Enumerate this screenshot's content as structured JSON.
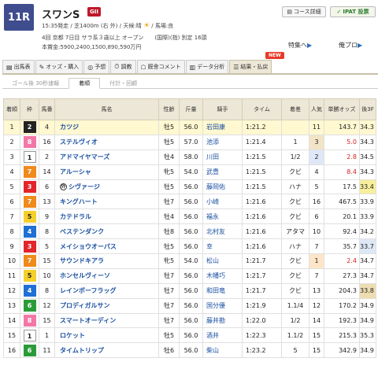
{
  "race": {
    "number": "11R",
    "name": "スワンS",
    "grade": "GII",
    "info1": "15:35発走 / 芝1400m (右 外) / 天候:晴",
    "weather_icon": "sun-icon",
    "info1_tail": "/ 馬場:良",
    "info2": "4回 京都 7日目 サラ系３歳以上 オープン　　(国際)(指) 別定 16頭",
    "info3": "本賞金:5900,2400,1500,890,590万円"
  },
  "header_buttons": {
    "course": "コース詳細",
    "ipat": "IPAT 投票",
    "feature": "特集へ",
    "mine": "俺プロ"
  },
  "tabs": [
    {
      "icon": "▤",
      "label": "出馬表"
    },
    {
      "icon": "✎",
      "label": "オッズ・購入"
    },
    {
      "icon": "◎",
      "label": "予想"
    },
    {
      "icon": "⏱",
      "label": "調教"
    },
    {
      "icon": "☖",
      "label": "厩舎コメント"
    },
    {
      "icon": "▥",
      "label": "データ分析"
    },
    {
      "icon": "☰",
      "label": "結果・払戻"
    }
  ],
  "new_badge": "NEW",
  "subtabs": [
    "ゴール後 30秒速報",
    "着順",
    "付計・回顧"
  ],
  "columns": [
    "着順",
    "枠",
    "馬番",
    "馬名",
    "性齢",
    "斤量",
    "騎手",
    "タイム",
    "着差",
    "人気",
    "単勝オッズ",
    "後3F"
  ],
  "rows": [
    {
      "pos": "1",
      "waku": "2",
      "num": "4",
      "name": "カツジ",
      "sex": "牡5",
      "wt": "56.0",
      "jockey": "岩田康",
      "time": "1:21.2",
      "margin": "",
      "pop": "11",
      "odds": "143.7",
      "l3f": "34.3"
    },
    {
      "pos": "2",
      "waku": "8",
      "num": "16",
      "name": "ステルヴィオ",
      "sex": "牡5",
      "wt": "57.0",
      "jockey": "池添",
      "time": "1:21.4",
      "margin": "1",
      "pop": "3",
      "odds": "5.0",
      "l3f": "34.3"
    },
    {
      "pos": "3",
      "waku": "1",
      "num": "2",
      "name": "アドマイヤマーズ",
      "sex": "牡4",
      "wt": "58.0",
      "jockey": "川田",
      "time": "1:21.5",
      "margin": "1/2",
      "pop": "2",
      "odds": "2.8",
      "l3f": "34.5"
    },
    {
      "pos": "4",
      "waku": "7",
      "num": "14",
      "name": "アルーシャ",
      "sex": "牝5",
      "wt": "54.0",
      "jockey": "武豊",
      "time": "1:21.5",
      "margin": "クビ",
      "pop": "4",
      "odds": "8.4",
      "l3f": "34.3"
    },
    {
      "pos": "5",
      "waku": "3",
      "num": "6",
      "name": "シヴァージ",
      "sex": "牡5",
      "wt": "56.0",
      "jockey": "藤岡佑",
      "time": "1:21.5",
      "margin": "ハナ",
      "pop": "5",
      "odds": "17.5",
      "l3f": "33.4",
      "maru": "外"
    },
    {
      "pos": "6",
      "waku": "7",
      "num": "13",
      "name": "キングハート",
      "sex": "牡7",
      "wt": "56.0",
      "jockey": "小崎",
      "time": "1:21.6",
      "margin": "クビ",
      "pop": "16",
      "odds": "467.5",
      "l3f": "33.9"
    },
    {
      "pos": "7",
      "waku": "5",
      "num": "9",
      "name": "カテドラル",
      "sex": "牡4",
      "wt": "56.0",
      "jockey": "福永",
      "time": "1:21.6",
      "margin": "クビ",
      "pop": "6",
      "odds": "20.1",
      "l3f": "33.9"
    },
    {
      "pos": "8",
      "waku": "4",
      "num": "8",
      "name": "ベステンダンク",
      "sex": "牡8",
      "wt": "56.0",
      "jockey": "北村友",
      "time": "1:21.6",
      "margin": "アタマ",
      "pop": "10",
      "odds": "92.4",
      "l3f": "34.2"
    },
    {
      "pos": "9",
      "waku": "3",
      "num": "5",
      "name": "メイショウオーパス",
      "sex": "牡5",
      "wt": "56.0",
      "jockey": "幸",
      "time": "1:21.6",
      "margin": "ハナ",
      "pop": "7",
      "odds": "35.7",
      "l3f": "33.7"
    },
    {
      "pos": "10",
      "waku": "7",
      "num": "15",
      "name": "サウンドキアラ",
      "sex": "牝5",
      "wt": "54.0",
      "jockey": "松山",
      "time": "1:21.7",
      "margin": "クビ",
      "pop": "1",
      "odds": "2.4",
      "l3f": "34.7"
    },
    {
      "pos": "11",
      "waku": "5",
      "num": "10",
      "name": "ホンセルヴィーソ",
      "sex": "牡7",
      "wt": "56.0",
      "jockey": "木幡巧",
      "time": "1:21.7",
      "margin": "クビ",
      "pop": "7",
      "odds": "27.3",
      "l3f": "34.7"
    },
    {
      "pos": "12",
      "waku": "4",
      "num": "8",
      "name": "レインボーフラッグ",
      "sex": "牡7",
      "wt": "56.0",
      "jockey": "和田竜",
      "time": "1:21.7",
      "margin": "クビ",
      "pop": "13",
      "odds": "204.3",
      "l3f": "33.8"
    },
    {
      "pos": "13",
      "waku": "6",
      "num": "12",
      "name": "プロディガルサン",
      "sex": "牡7",
      "wt": "56.0",
      "jockey": "国分優",
      "time": "1:21.9",
      "margin": "1.1/4",
      "pop": "12",
      "odds": "170.2",
      "l3f": "34.9"
    },
    {
      "pos": "14",
      "waku": "8",
      "num": "15",
      "name": "スマートオーディン",
      "sex": "牡7",
      "wt": "56.0",
      "jockey": "藤井勘",
      "time": "1:22.0",
      "margin": "1/2",
      "pop": "14",
      "odds": "192.3",
      "l3f": "34.9"
    },
    {
      "pos": "15",
      "waku": "1",
      "num": "1",
      "name": "ロケット",
      "sex": "牡5",
      "wt": "56.0",
      "jockey": "酒井",
      "time": "1:22.3",
      "margin": "1.1/2",
      "pop": "15",
      "odds": "215.3",
      "l3f": "35.3"
    },
    {
      "pos": "16",
      "waku": "6",
      "num": "11",
      "name": "タイムトリップ",
      "sex": "牡6",
      "wt": "56.0",
      "jockey": "柴山",
      "time": "1:23.2",
      "margin": "5",
      "pop": "15",
      "odds": "342.9",
      "l3f": "34.9"
    }
  ],
  "highlight_colors": {
    "win_row": "#fff8d0",
    "fav1": "#fde6c8",
    "fav2": "#dfe8f8",
    "fav3": "#f2e4c6",
    "l3f_best": "#f7ef9c",
    "odds_red": "#d81e1e"
  }
}
